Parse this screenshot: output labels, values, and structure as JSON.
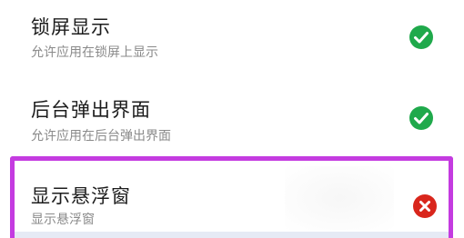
{
  "settings": [
    {
      "title": "锁屏显示",
      "subtitle": "允许应用在锁屏上显示",
      "status": "enabled",
      "status_icon": "check-circle-icon",
      "status_color": "#1fa94b"
    },
    {
      "title": "后台弹出界面",
      "subtitle": "允许应用在后台弹出界面",
      "status": "enabled",
      "status_icon": "check-circle-icon",
      "status_color": "#1fa94b"
    },
    {
      "title": "显示悬浮窗",
      "subtitle": "显示悬浮窗",
      "status": "disabled",
      "status_icon": "close-circle-icon",
      "status_color": "#d9261c",
      "highlighted": true,
      "highlight_color": "#c43be0"
    }
  ]
}
